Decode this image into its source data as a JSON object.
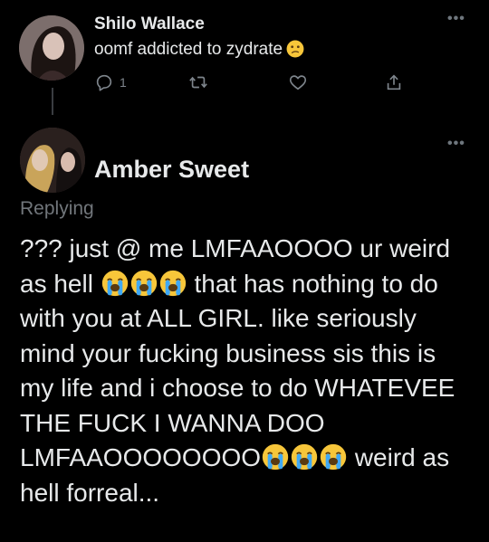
{
  "tweet1": {
    "display_name": "Shilo Wallace",
    "text": "oomf addicted to zydrate",
    "reply_count": "1",
    "icons": {
      "reply": "reply-icon",
      "retweet": "retweet-icon",
      "like": "heart-icon",
      "share": "share-icon",
      "more": "more-icon"
    }
  },
  "more_glyph": "•••",
  "tweet2": {
    "display_name": "Amber Sweet",
    "replying_label": "Replying",
    "line1": "??? just @ me LMFAAOOOO ur weird",
    "line2_prefix": "as hell",
    "line2_suffix": "that has nothing to do",
    "line3": "with you at ALL GIRL. like seriously",
    "line4": "mind your fucking business sis this is",
    "line5": "my life and i choose to do WHATEVEE",
    "line6": "THE FUCK I WANNA DOO",
    "line7_prefix": "LMFAAOOOOOOOO",
    "line7_suffix": "weird as",
    "line8": "hell forreal..."
  },
  "colors": {
    "background": "#000000",
    "text": "#e7e9ea",
    "muted": "#71767b",
    "emoji": "#f7c63a",
    "tears": "#3fa9f5"
  }
}
